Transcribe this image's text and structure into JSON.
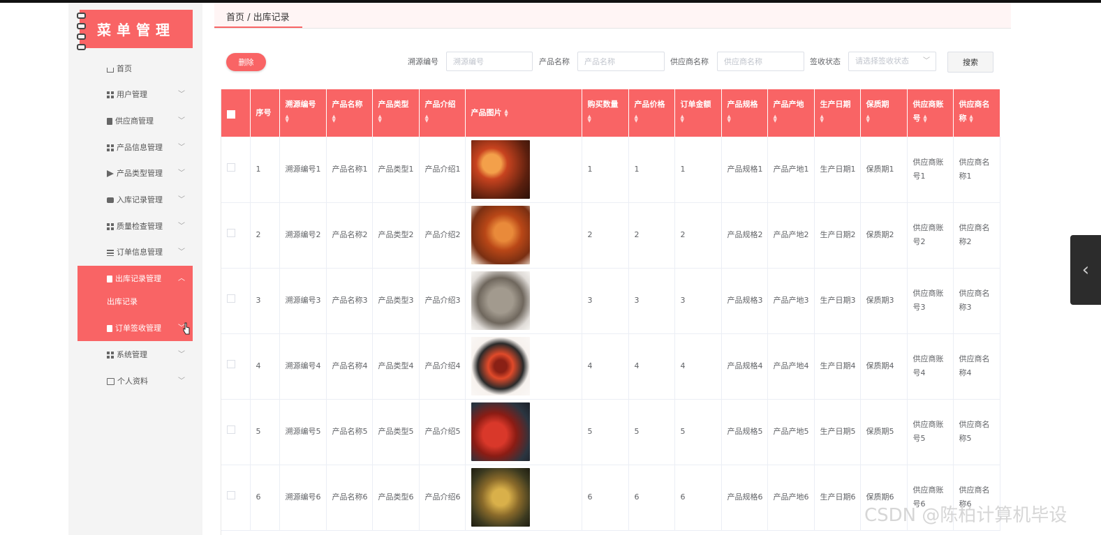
{
  "app": {
    "logo_text": "菜单管理",
    "accent": "#f96465"
  },
  "sidebar": {
    "items": [
      {
        "label": "首页",
        "icon": "home-icon"
      },
      {
        "label": "用户管理",
        "icon": "grid-icon"
      },
      {
        "label": "供应商管理",
        "icon": "doc-icon"
      },
      {
        "label": "产品信息管理",
        "icon": "grid-icon"
      },
      {
        "label": "产品类型管理",
        "icon": "send-icon"
      },
      {
        "label": "入库记录管理",
        "icon": "chat-icon"
      },
      {
        "label": "质量检查管理",
        "icon": "grid-icon"
      },
      {
        "label": "订单信息管理",
        "icon": "list-icon"
      },
      {
        "label": "出库记录管理",
        "icon": "doc-icon"
      },
      {
        "label": "出库记录",
        "icon": ""
      },
      {
        "label": "订单签收管理",
        "icon": "bag-icon"
      },
      {
        "label": "系统管理",
        "icon": "grid-icon"
      },
      {
        "label": "个人资料",
        "icon": "card-icon"
      }
    ]
  },
  "breadcrumb": "首页 / 出库记录",
  "toolbar": {
    "delete_label": "删除",
    "search_label": "搜索"
  },
  "filters": [
    {
      "label": "溯源编号",
      "placeholder": "溯源编号"
    },
    {
      "label": "产品名称",
      "placeholder": "产品名称"
    },
    {
      "label": "供应商名称",
      "placeholder": "供应商名称"
    },
    {
      "label": "签收状态",
      "placeholder": "请选择签收状态"
    }
  ],
  "table": {
    "headers": [
      "",
      "序号",
      "溯源编号",
      "产品名称",
      "产品类型",
      "产品介绍",
      "产品图片",
      "购买数量",
      "产品价格",
      "订单金额",
      "产品规格",
      "产品产地",
      "生产日期",
      "保质期",
      "供应商账号",
      "供应商名称"
    ],
    "rows": [
      [
        "1",
        "溯源编号1",
        "产品名称1",
        "产品类型1",
        "产品介绍1",
        "",
        "1",
        "1",
        "1",
        "产品规格1",
        "产品产地1",
        "生产日期1",
        "保质期1",
        "供应商账号1",
        "供应商名称1"
      ],
      [
        "2",
        "溯源编号2",
        "产品名称2",
        "产品类型2",
        "产品介绍2",
        "",
        "2",
        "2",
        "2",
        "产品规格2",
        "产品产地2",
        "生产日期2",
        "保质期2",
        "供应商账号2",
        "供应商名称2"
      ],
      [
        "3",
        "溯源编号3",
        "产品名称3",
        "产品类型3",
        "产品介绍3",
        "",
        "3",
        "3",
        "3",
        "产品规格3",
        "产品产地3",
        "生产日期3",
        "保质期3",
        "供应商账号3",
        "供应商名称3"
      ],
      [
        "4",
        "溯源编号4",
        "产品名称4",
        "产品类型4",
        "产品介绍4",
        "",
        "4",
        "4",
        "4",
        "产品规格4",
        "产品产地4",
        "生产日期4",
        "保质期4",
        "供应商账号4",
        "供应商名称4"
      ],
      [
        "5",
        "溯源编号5",
        "产品名称5",
        "产品类型5",
        "产品介绍5",
        "",
        "5",
        "5",
        "5",
        "产品规格5",
        "产品产地5",
        "生产日期5",
        "保质期5",
        "供应商账号5",
        "供应商名称5"
      ],
      [
        "6",
        "溯源编号6",
        "产品名称6",
        "产品类型6",
        "产品介绍6",
        "",
        "6",
        "6",
        "6",
        "产品规格6",
        "产品产地6",
        "生产日期6",
        "保质期6",
        "供应商账号6",
        "供应商名称6"
      ]
    ]
  },
  "watermark": "CSDN @陈柏计算机毕设"
}
